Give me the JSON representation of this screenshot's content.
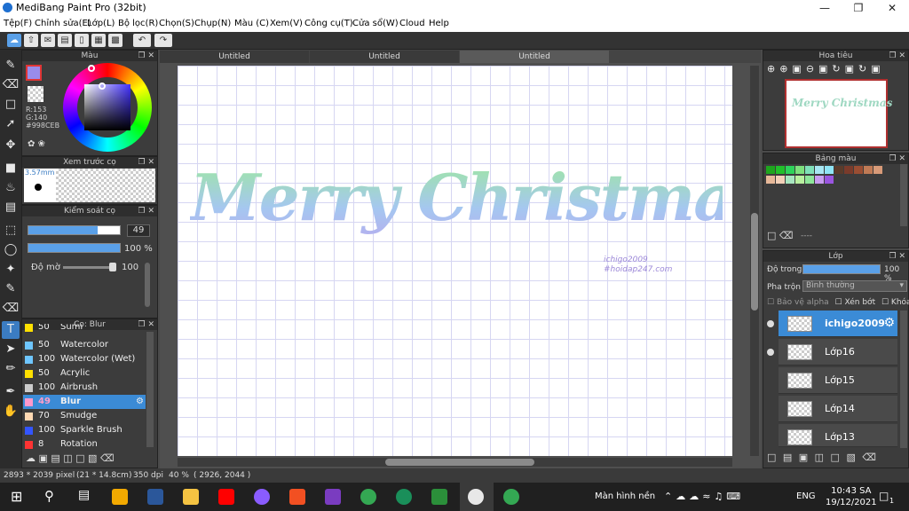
{
  "app": {
    "title": "MediBang Paint Pro (32bit)"
  },
  "menu": [
    "Tệp(F)",
    "Chỉnh sửa(E)",
    "Lớp(L)",
    "Bộ lọc(R)",
    "Chọn(S)",
    "Chụp(N)",
    "Màu (C)",
    "Xem(V)",
    "Công cụ(T)",
    "Cửa sổ(W)",
    "Cloud",
    "Help"
  ],
  "tabs": [
    "Untitled",
    "Untitled",
    "Untitled"
  ],
  "color_panel": {
    "title": "Màu",
    "r": "R:153",
    "g": "G:140",
    "hex": "#998CEB",
    "primary_color": "#998CEB"
  },
  "brush_preview": {
    "title": "Xem trước cọ",
    "size": "3.57mm"
  },
  "brush_control": {
    "title": "Kiểm soát cọ",
    "size_value": "49",
    "opacity_value": "100 %",
    "density_label": "Độ mờ",
    "density_value": "100"
  },
  "brush_list": {
    "title": "Cọ: Blur",
    "items": [
      {
        "size": "50",
        "name": "Sumi",
        "color": "#ffe000"
      },
      {
        "size": "50",
        "name": "Watercolor",
        "color": "#6ec6ff"
      },
      {
        "size": "100",
        "name": "Watercolor (Wet)",
        "color": "#6ec6ff"
      },
      {
        "size": "50",
        "name": "Acrylic",
        "color": "#ffe000"
      },
      {
        "size": "100",
        "name": "Airbrush",
        "color": "#cccccc"
      },
      {
        "size": "49",
        "name": "Blur",
        "color": "#ff99cc"
      },
      {
        "size": "70",
        "name": "Smudge",
        "color": "#ffd9b3"
      },
      {
        "size": "100",
        "name": "Sparkle Brush",
        "color": "#3355ff"
      },
      {
        "size": "8",
        "name": "Rotation Symmetry",
        "color": "#ff3333"
      }
    ]
  },
  "canvas": {
    "text": "Merry Christmas",
    "watermark_line1": "ichigo2009",
    "watermark_line2": "#hoidap247.com"
  },
  "navigator": {
    "title": "Hoa tiêu"
  },
  "palette": {
    "title": "Bảng màu",
    "placeholder": "----",
    "colors": [
      "#1ea51e",
      "#21c02b",
      "#2ed35a",
      "#7de07d",
      "#7fe0b8",
      "#a7e6f2",
      "#8fe4f5",
      "#5a3b2b",
      "#7a3b2b",
      "#9a4e33",
      "#c07a55",
      "#d89a78",
      "#e6b899",
      "#f2d0b8",
      "#a8e6c0",
      "#b9f0a0",
      "#8ee69a",
      "#c89cf0",
      "#9a55e0"
    ]
  },
  "layers": {
    "title": "Lớp",
    "opacity_label": "Độ trong",
    "opacity_value": "100 %",
    "blend_label": "Pha trộn",
    "blend_value": "Bình thường",
    "protect_alpha": "Bảo vệ alpha",
    "clip": "Xén bớt",
    "lock": "Khóa",
    "items": [
      {
        "name": "ichigo2009",
        "visible": true
      },
      {
        "name": "Lớp16",
        "visible": true
      },
      {
        "name": "Lớp15",
        "visible": false
      },
      {
        "name": "Lớp14",
        "visible": false
      },
      {
        "name": "Lớp13",
        "visible": false
      }
    ]
  },
  "status": {
    "size": "2893 * 2039 pixel",
    "dims": "(21 * 14.8cm)",
    "dpi": "350 dpi",
    "zoom": "40 %",
    "coords": "( 2926, 2044 )"
  },
  "taskbar": {
    "screen_label": "Màn hình nền",
    "lang": "ENG",
    "time": "10:43 SA",
    "date": "19/12/2021",
    "notif": "1"
  }
}
